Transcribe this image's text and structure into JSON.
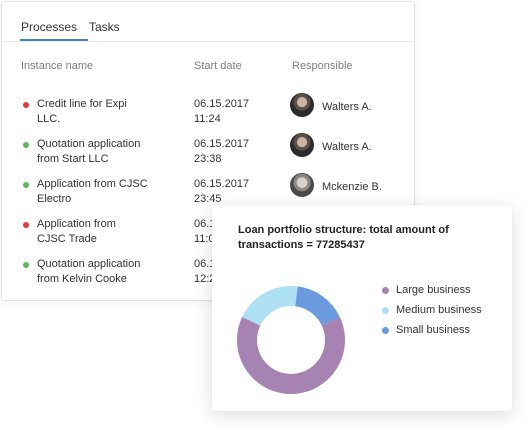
{
  "tabs": {
    "processes": "Processes",
    "tasks": "Tasks"
  },
  "table": {
    "headers": {
      "name": "Instance name",
      "date": "Start date",
      "responsible": "Responsible"
    },
    "rows": [
      {
        "status": "red",
        "name_line1": "Credit line for Expi",
        "name_line2": "LLC.",
        "date": "06.15.2017",
        "time": "11:24",
        "responsible": "Walters A."
      },
      {
        "status": "green",
        "name_line1": "Quotation application",
        "name_line2": "from Start LLC",
        "date": "06.15.2017",
        "time": "23:38",
        "responsible": "Walters A."
      },
      {
        "status": "green",
        "name_line1": "Application from CJSC",
        "name_line2": "Electro",
        "date": "06.15.2017",
        "time": "23:45",
        "responsible": "Mckenzie B."
      },
      {
        "status": "red",
        "name_line1": "Application from",
        "name_line2": "CJSC Trade",
        "date": "06.1",
        "time": "11:0",
        "responsible": ""
      },
      {
        "status": "green",
        "name_line1": "Quotation application",
        "name_line2": "from Kelvin Cooke",
        "date": "06.1",
        "time": "12:2",
        "responsible": ""
      }
    ]
  },
  "status_colors": {
    "red": "#e0393e",
    "green": "#5cb85c"
  },
  "chart_data": {
    "type": "pie",
    "title": "Loan portfolio structure: total amount of transactions = 77285437",
    "series": [
      {
        "name": "Large business",
        "value": 64,
        "color": "#a783b3"
      },
      {
        "name": "Medium business",
        "value": 20,
        "color": "#aee0f3"
      },
      {
        "name": "Small business",
        "value": 16,
        "color": "#6c9ade"
      }
    ],
    "donut": true,
    "legend_position": "right"
  }
}
